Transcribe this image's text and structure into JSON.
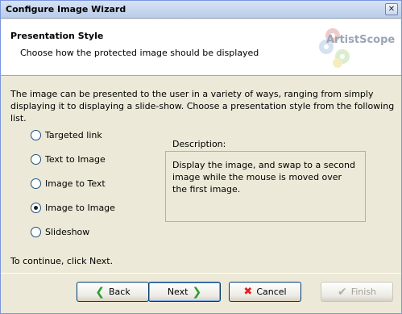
{
  "window": {
    "title": "Configure Image Wizard",
    "close_glyph": "✕"
  },
  "header": {
    "title": "Presentation Style",
    "subtitle": "Choose how the protected image should be displayed",
    "logo_text": "ArtistScope"
  },
  "intro": "The image can be presented to the user in a variety of ways, ranging from simply displaying it to displaying a slide-show. Choose a presentation style from the following list.",
  "styles": [
    {
      "label": "Targeted link",
      "checked": false
    },
    {
      "label": "Text to Image",
      "checked": false
    },
    {
      "label": "Image to Text",
      "checked": false
    },
    {
      "label": "Image to Image",
      "checked": true
    },
    {
      "label": "Slideshow",
      "checked": false
    }
  ],
  "description": {
    "label": "Description:",
    "text": "Display the image, and swap to a second image while the mouse is moved over the first image."
  },
  "continue_text": "To continue, click Next.",
  "buttons": {
    "back": {
      "label": "Back",
      "icon": "back-arrow-icon"
    },
    "next": {
      "label": "Next",
      "icon": "next-arrow-icon"
    },
    "cancel": {
      "label": "Cancel",
      "icon": "cancel-x-icon"
    },
    "finish": {
      "label": "Finish",
      "icon": "checkmark-icon",
      "disabled": true
    }
  }
}
